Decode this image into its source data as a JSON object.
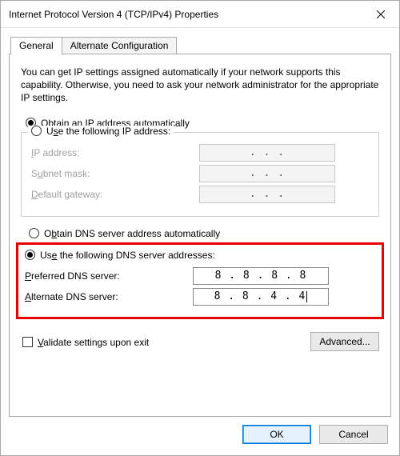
{
  "window": {
    "title": "Internet Protocol Version 4 (TCP/IPv4) Properties"
  },
  "tabs": {
    "general": "General",
    "alternate": "Alternate Configuration"
  },
  "intro": "You can get IP settings assigned automatically if your network supports this capability. Otherwise, you need to ask your network administrator for the appropriate IP settings.",
  "ip": {
    "auto_label_pre": "O",
    "auto_label_post": "btain an IP address automatically",
    "manual_label": "se the following IP address:",
    "manual_prefix": "U",
    "ip_address_label": "P address:",
    "ip_address_prefix": "I",
    "subnet_label": "bnet mask:",
    "subnet_prefix": "S",
    "subnet_under": "u",
    "gateway_label": "efault gateway:",
    "gateway_prefix": "D",
    "ip_value": "",
    "subnet_value": "",
    "gateway_value": ""
  },
  "dns": {
    "auto_label": "btain DNS server address automatically",
    "auto_prefix": "O",
    "manual_label": "se the following DNS server addresses:",
    "manual_prefix": "U",
    "preferred_label": "referred DNS server:",
    "preferred_prefix": "P",
    "alternate_label": "lternate DNS server:",
    "alternate_prefix": "A",
    "preferred_value": "8 . 8 . 8 . 8",
    "alternate_value": "8 . 8 . 4 . 4"
  },
  "validate": {
    "label": "alidate settings upon exit",
    "prefix": "V"
  },
  "buttons": {
    "advanced": "Advanced...",
    "ok": "OK",
    "cancel": "Cancel"
  },
  "dots": ".       .       ."
}
